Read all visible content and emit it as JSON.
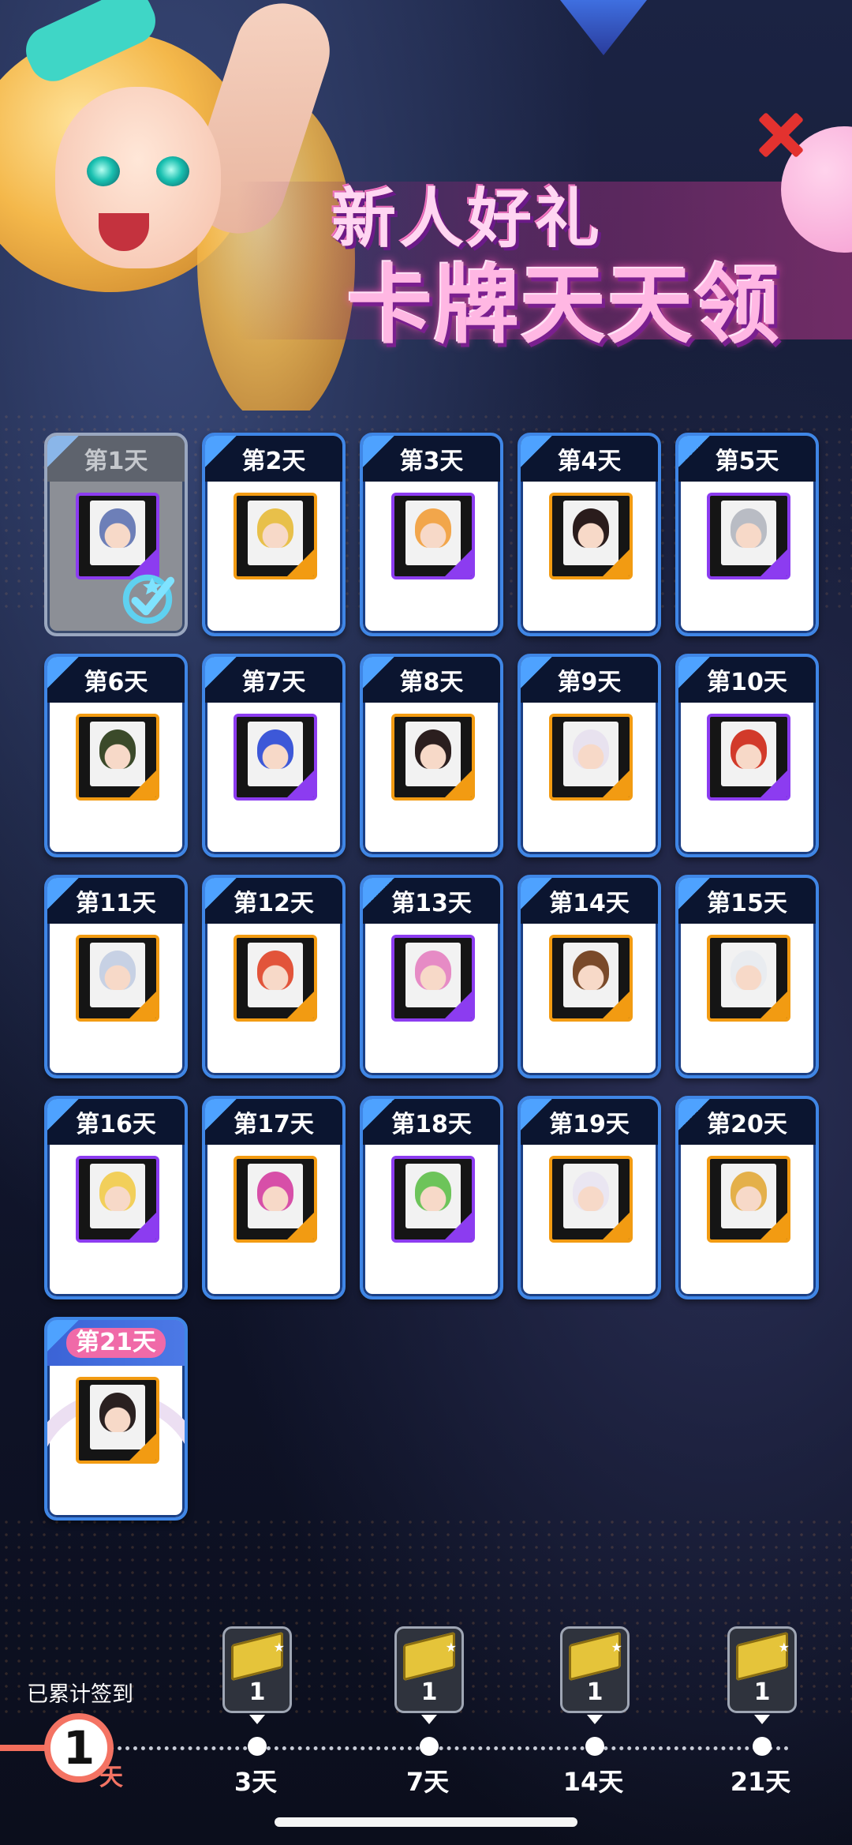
{
  "banner": {
    "title_line1": "新人好礼",
    "title_line2": "卡牌天天领"
  },
  "days": [
    {
      "label": "第1天",
      "frame": "purple",
      "claimed": true
    },
    {
      "label": "第2天",
      "frame": "orange",
      "claimed": false
    },
    {
      "label": "第3天",
      "frame": "purple",
      "claimed": false
    },
    {
      "label": "第4天",
      "frame": "orange",
      "claimed": false
    },
    {
      "label": "第5天",
      "frame": "purple",
      "claimed": false
    },
    {
      "label": "第6天",
      "frame": "orange",
      "claimed": false
    },
    {
      "label": "第7天",
      "frame": "purple",
      "claimed": false
    },
    {
      "label": "第8天",
      "frame": "orange",
      "claimed": false
    },
    {
      "label": "第9天",
      "frame": "orange",
      "claimed": false
    },
    {
      "label": "第10天",
      "frame": "purple",
      "claimed": false
    },
    {
      "label": "第11天",
      "frame": "orange",
      "claimed": false
    },
    {
      "label": "第12天",
      "frame": "orange",
      "claimed": false
    },
    {
      "label": "第13天",
      "frame": "purple",
      "claimed": false
    },
    {
      "label": "第14天",
      "frame": "orange",
      "claimed": false
    },
    {
      "label": "第15天",
      "frame": "orange",
      "claimed": false
    },
    {
      "label": "第16天",
      "frame": "purple",
      "claimed": false
    },
    {
      "label": "第17天",
      "frame": "orange",
      "claimed": false
    },
    {
      "label": "第18天",
      "frame": "purple",
      "claimed": false
    },
    {
      "label": "第19天",
      "frame": "orange",
      "claimed": false
    },
    {
      "label": "第20天",
      "frame": "orange",
      "claimed": false
    },
    {
      "label": "第21天",
      "frame": "orange",
      "claimed": false
    }
  ],
  "progress": {
    "label": "已累计签到",
    "count": "1",
    "unit": "天",
    "milestones": [
      {
        "day": "3天",
        "qty": "1"
      },
      {
        "day": "7天",
        "qty": "1"
      },
      {
        "day": "14天",
        "qty": "1"
      },
      {
        "day": "21天",
        "qty": "1"
      }
    ]
  },
  "colors": {
    "card_border": "#3f86e6",
    "orange_frame": "#f29b12",
    "purple_frame": "#8c3cf0",
    "progress_accent": "#f47363",
    "close": "#e3322f"
  }
}
